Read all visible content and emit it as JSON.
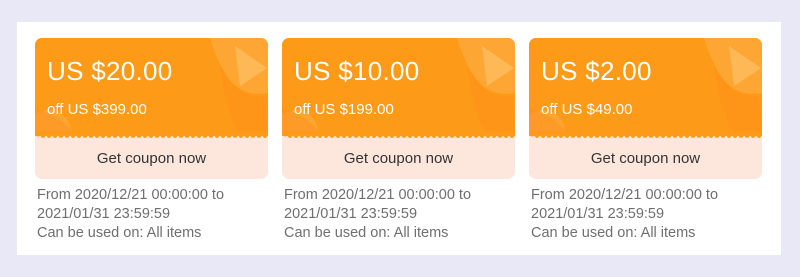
{
  "colors": {
    "page_background": "#e8e8f6",
    "coupon_orange": "#fd9a17",
    "coupon_bottom": "#fde7dc",
    "info_text": "#6f6f6f"
  },
  "coupons": [
    {
      "amount": "US $20.00",
      "condition": "off US $399.00",
      "button_label": "Get coupon now",
      "valid_line1": "From 2020/12/21 00:00:00 to",
      "valid_line2": "2021/01/31 23:59:59",
      "usage": "Can be used on: All items"
    },
    {
      "amount": "US $10.00",
      "condition": "off US $199.00",
      "button_label": "Get coupon now",
      "valid_line1": "From 2020/12/21 00:00:00 to",
      "valid_line2": "2021/01/31 23:59:59",
      "usage": "Can be used on: All items"
    },
    {
      "amount": "US $2.00",
      "condition": "off US $49.00",
      "button_label": "Get coupon now",
      "valid_line1": "From 2020/12/21 00:00:00 to",
      "valid_line2": "2021/01/31 23:59:59",
      "usage": "Can be used on: All items"
    }
  ]
}
